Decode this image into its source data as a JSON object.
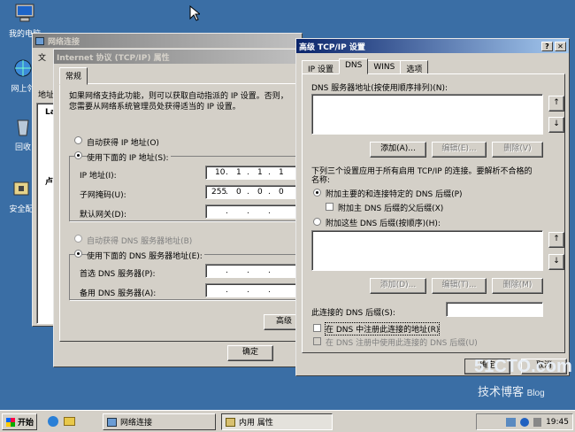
{
  "desktop": {
    "icons": [
      {
        "label": "我的电脑"
      },
      {
        "label": "网上邻"
      },
      {
        "label": "回收"
      },
      {
        "label": "安全配"
      }
    ]
  },
  "netconn_window": {
    "title": "网络连接",
    "menu_first": "文",
    "side_label": "地址",
    "side_tab_1": "La",
    "side_tab_2": "卢"
  },
  "tcpip_window": {
    "title": "Internet 协议 (TCP/IP) 属性",
    "tab_general": "常规",
    "intro": "如果网络支持此功能，则可以获取自动指派的 IP 设置。否则，",
    "intro2": "您需要从网络系统管理员处获得适当的 IP 设置。",
    "auto_ip": "自动获得 IP 地址(O)",
    "manual_ip": "使用下面的 IP 地址(S):",
    "ip_label": "IP 地址(I):",
    "ip_value": [
      "10",
      "1",
      "1",
      "1"
    ],
    "mask_label": "子网掩码(U):",
    "mask_value": [
      "255",
      "0",
      "0",
      "0"
    ],
    "gateway_label": "默认网关(D):",
    "auto_dns": "自动获得 DNS 服务器地址(B)",
    "manual_dns": "使用下面的 DNS 服务器地址(E):",
    "pref_dns": "首选 DNS 服务器(P):",
    "alt_dns": "备用 DNS 服务器(A):",
    "advanced_btn": "高级",
    "ok_btn": "确定",
    "ok_btn_back": "确定"
  },
  "advanced_window": {
    "title": "高级 TCP/IP 设置",
    "tabs": [
      "IP 设置",
      "DNS",
      "WINS",
      "选项"
    ],
    "dns_list_label": "DNS 服务器地址(按使用顺序排列)(N):",
    "add_btn": "添加(A)...",
    "edit_btn": "编辑(E)...",
    "remove_btn": "删除(V)",
    "info": "下列三个设置应用于所有启用 TCP/IP 的连接。要解析不合格的",
    "info2": "名称:",
    "append_primary": "附加主要的和连接特定的 DNS 后缀(P)",
    "append_parent": "附加主 DNS 后缀的父后缀(X)",
    "append_these": "附加这些 DNS 后缀(按顺序)(H):",
    "add_btn2": "添加(D)...",
    "edit_btn2": "编辑(T)...",
    "remove_btn2": "删除(M)",
    "conn_suffix": "此连接的 DNS 后缀(S):",
    "register": "在 DNS 中注册此连接的地址(R)",
    "register_suffix": "在 DNS 注册中使用此连接的 DNS 后缀(U)",
    "ok_btn": "确定",
    "cancel_btn": "取消"
  },
  "taskbar": {
    "start": "开始",
    "task1": "网络连接",
    "task2": "内用 属性",
    "clock": "19:45"
  },
  "watermark": {
    "line1": "51CTO.com",
    "line2": "技术博客",
    "line3": "Blog"
  },
  "colors": {
    "desktop": "#3a6ea5",
    "active_title": "#0a246a",
    "face": "#d4d0c8"
  }
}
